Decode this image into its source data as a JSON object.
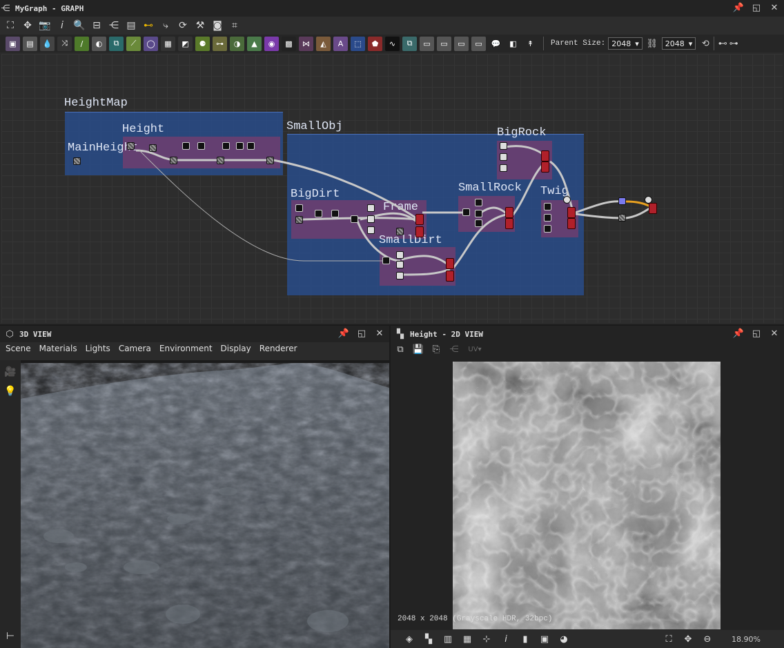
{
  "graph_panel": {
    "title": "MyGraph - GRAPH",
    "parent_size_label": "Parent Size:",
    "parent_size_w": "2048",
    "parent_size_h": "2048",
    "frames": {
      "heightmap": "HeightMap",
      "height": "Height",
      "mainheight": "MainHeight",
      "smallobj": "SmallObj",
      "bigdirt": "BigDirt",
      "frame": "Frame",
      "smalldirt": "SmallDirt",
      "smallrock": "SmallRock",
      "bigrock": "BigRock",
      "twig": "Twig"
    }
  },
  "view3d": {
    "title": "3D VIEW",
    "menu": [
      "Scene",
      "Materials",
      "Lights",
      "Camera",
      "Environment",
      "Display",
      "Renderer"
    ]
  },
  "view2d": {
    "title": "Height - 2D VIEW",
    "uv_label": "UV",
    "info": "2048 x 2048 (Grayscale HDR, 32bpc)",
    "zoom": "18.90%"
  },
  "colors": {
    "frame_blue": "#2a4f93",
    "frame_purple": "#7a3d6e",
    "node_red": "#b0202a"
  }
}
